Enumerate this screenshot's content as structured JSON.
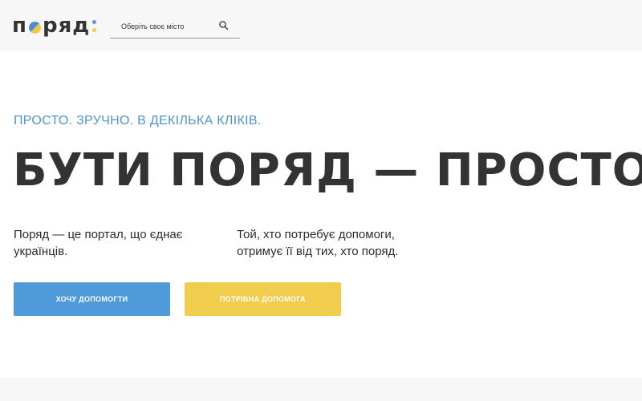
{
  "header": {
    "logo": {
      "before_globe": "п",
      "after_globe": "ряд"
    },
    "search": {
      "placeholder": "Оберіть своє місто"
    }
  },
  "hero": {
    "tagline": "ПРОСТО. ЗРУЧНО. В ДЕКІЛЬКА КЛІКІВ.",
    "headline": "БУТИ ПОРЯД — ПРОСТО",
    "description_left": "Поряд — це портал, що єднає українців.",
    "description_right": "Той, хто потребує допомоги, отримує її від тих, хто поряд.",
    "buttons": {
      "want_to_help": "ХОЧУ ДОПОМОГТИ",
      "need_help": "ПОТРІБНА ДОПОМОГА"
    }
  },
  "icons": {
    "globe": "globe-icon",
    "search": "search-icon"
  },
  "colors": {
    "accent_blue": "#4f9ad8",
    "accent_yellow": "#f0cd4d",
    "text_dark": "#333333",
    "header_bg": "#f7f7f7"
  }
}
